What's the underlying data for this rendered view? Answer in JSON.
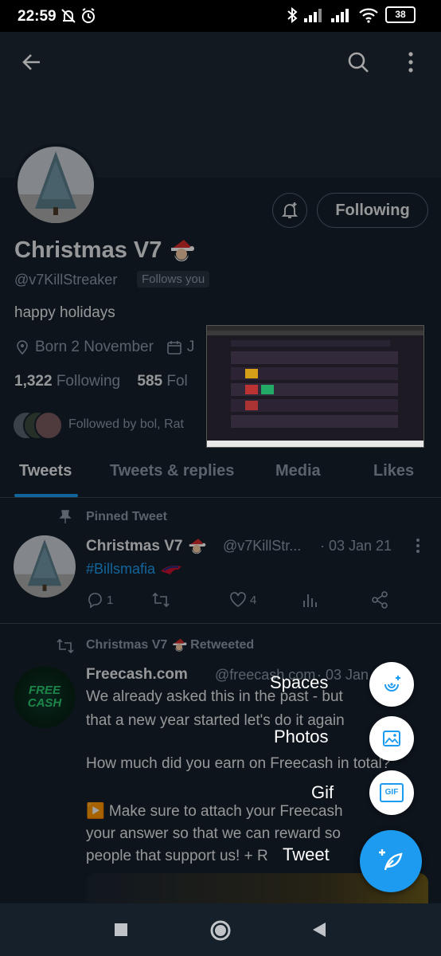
{
  "status_bar": {
    "time": "22:59",
    "battery": "38"
  },
  "profile": {
    "name": "Christmas V7",
    "handle": "@v7KillStreaker",
    "follows_you": "Follows you",
    "bio": "happy holidays",
    "born": "Born 2 November",
    "joined_partial": "J",
    "following_count": "1,322",
    "following_label": "Following",
    "followers_count": "585",
    "followers_label_partial": "Fol",
    "followed_by": "Followed by bol, Rat",
    "following_button": "Following"
  },
  "tabs": [
    {
      "label": "Tweets"
    },
    {
      "label": "Tweets & replies"
    },
    {
      "label": "Media"
    },
    {
      "label": "Likes"
    }
  ],
  "pinned_tweet": {
    "label": "Pinned Tweet",
    "name": "Christmas V7",
    "handle": "@v7KillStr...",
    "date": "· 03 Jan 21",
    "text": "#Billsmafia",
    "replies": "1",
    "likes": "4"
  },
  "retweet": {
    "label": "Christmas V7",
    "label_suffix": "Retweeted",
    "avatar_text": "FREE CASH",
    "name": "Freecash.com",
    "handle": "@freecash.com",
    "date": "· 03 Jan",
    "lines": [
      "We already asked this in the past - but",
      "that a new year started let's do it again",
      "",
      "How much did you earn on Freecash in total?",
      "",
      "▶️ Make sure to attach your Freecash",
      "your answer so that we can reward so",
      "people that support us! + R"
    ]
  },
  "fab_menu": {
    "spaces": "Spaces",
    "photos": "Photos",
    "gif": "Gif",
    "gif_icon_text": "GIF",
    "tweet": "Tweet"
  },
  "colors": {
    "accent": "#1d9bf0",
    "background": "#15202b",
    "header": "#1c2732"
  }
}
